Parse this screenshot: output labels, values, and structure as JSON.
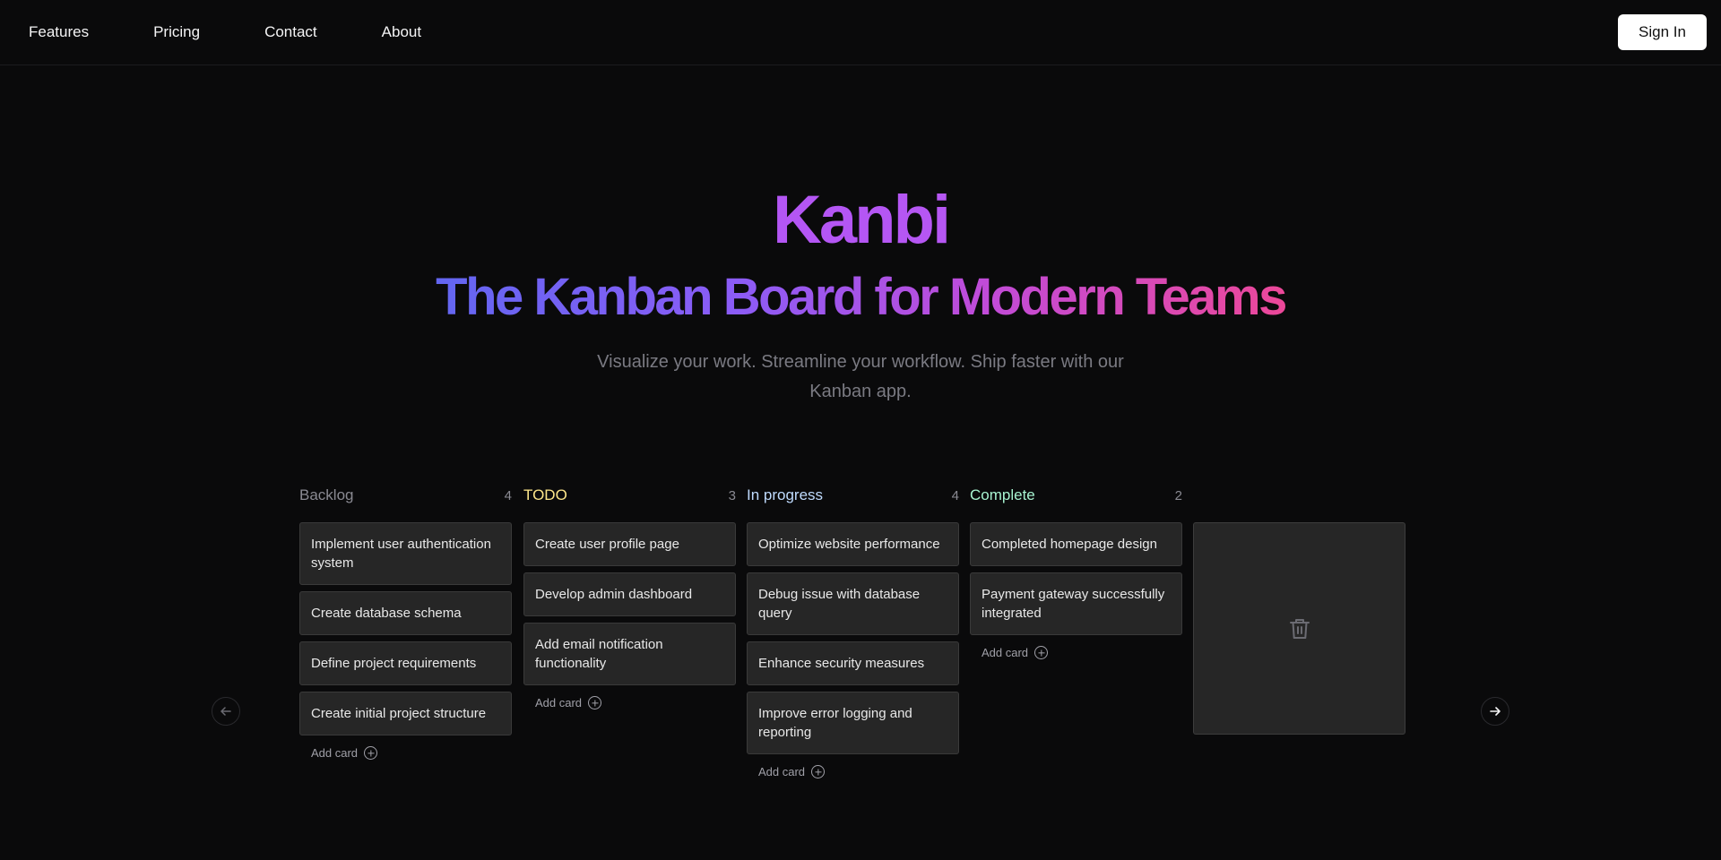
{
  "nav": {
    "links": [
      "Features",
      "Pricing",
      "Contact",
      "About"
    ],
    "sign_in": "Sign In"
  },
  "hero": {
    "brand": "Kanbi",
    "headline": "The Kanban Board for Modern Teams",
    "subtitle": "Visualize your work. Streamline your workflow. Ship faster with our Kanban app."
  },
  "board": {
    "add_card_label": "Add card",
    "columns": [
      {
        "title": "Backlog",
        "count": "4",
        "color": "#8a8a92",
        "cards": [
          "Implement user authentication system",
          "Create database schema",
          "Define project requirements",
          "Create initial project structure"
        ]
      },
      {
        "title": "TODO",
        "count": "3",
        "color": "#fde68a",
        "cards": [
          "Create user profile page",
          "Develop admin dashboard",
          "Add email notification functionality"
        ]
      },
      {
        "title": "In progress",
        "count": "4",
        "color": "#bfdbfe",
        "cards": [
          "Optimize website performance",
          "Debug issue with database query",
          "Enhance security measures",
          "Improve error logging and reporting"
        ]
      },
      {
        "title": "Complete",
        "count": "2",
        "color": "#a7f3d0",
        "cards": [
          "Completed homepage design",
          "Payment gateway successfully integrated"
        ]
      }
    ],
    "trash_icon": "trash-icon",
    "prev_icon": "arrow-left-icon",
    "next_icon": "arrow-right-icon"
  }
}
